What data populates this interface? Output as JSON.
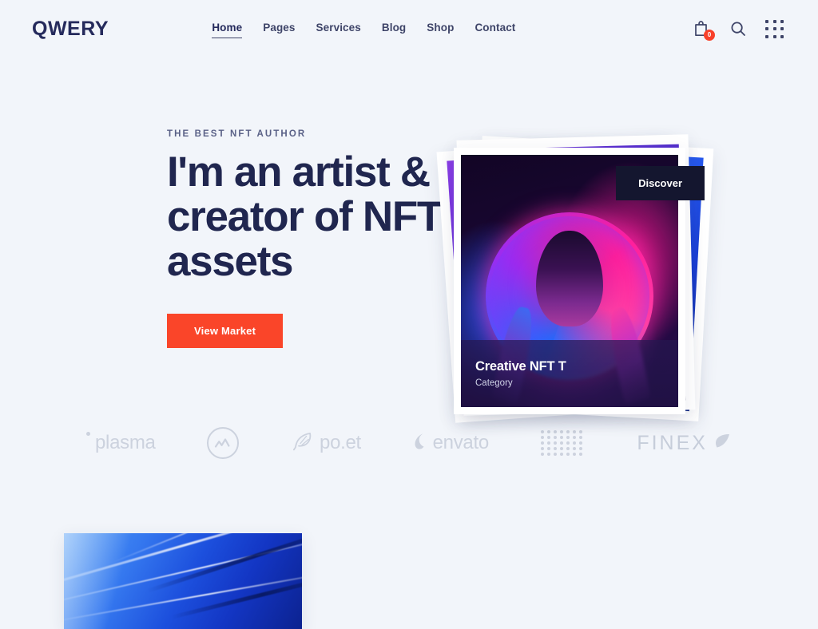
{
  "header": {
    "logo": "QWERY",
    "nav": [
      {
        "label": "Home",
        "active": true
      },
      {
        "label": "Pages",
        "active": false
      },
      {
        "label": "Services",
        "active": false
      },
      {
        "label": "Blog",
        "active": false
      },
      {
        "label": "Shop",
        "active": false
      },
      {
        "label": "Contact",
        "active": false
      }
    ],
    "icons": {
      "cart": "cart-icon",
      "cart_badge": "0",
      "search": "search-icon",
      "grid": "grid-menu-icon"
    }
  },
  "hero": {
    "eyebrow": "THE BEST NFT AUTHOR",
    "title": "I'm an artist &\ncreator of NFT\nassets",
    "cta": "View Market"
  },
  "showcase": {
    "card_title": "Creative NFT T",
    "card_category": "Category",
    "discover": "Discover"
  },
  "brands": [
    {
      "name": "plasma",
      "icon": "plasma-logo"
    },
    {
      "name": "CoinMarketCap",
      "icon": "coinmarketcap-logo"
    },
    {
      "name": "po.et",
      "icon": "poet-logo"
    },
    {
      "name": "envato",
      "icon": "envato-logo"
    },
    {
      "name": "IOTA",
      "icon": "iota-logo"
    },
    {
      "name": "FINEX",
      "icon": "finex-logo"
    }
  ],
  "colors": {
    "background": "#f2f5fa",
    "navy": "#20264f",
    "accent_orange": "#fa4529",
    "badge_red": "#f8402a",
    "muted": "#ccd2de"
  }
}
